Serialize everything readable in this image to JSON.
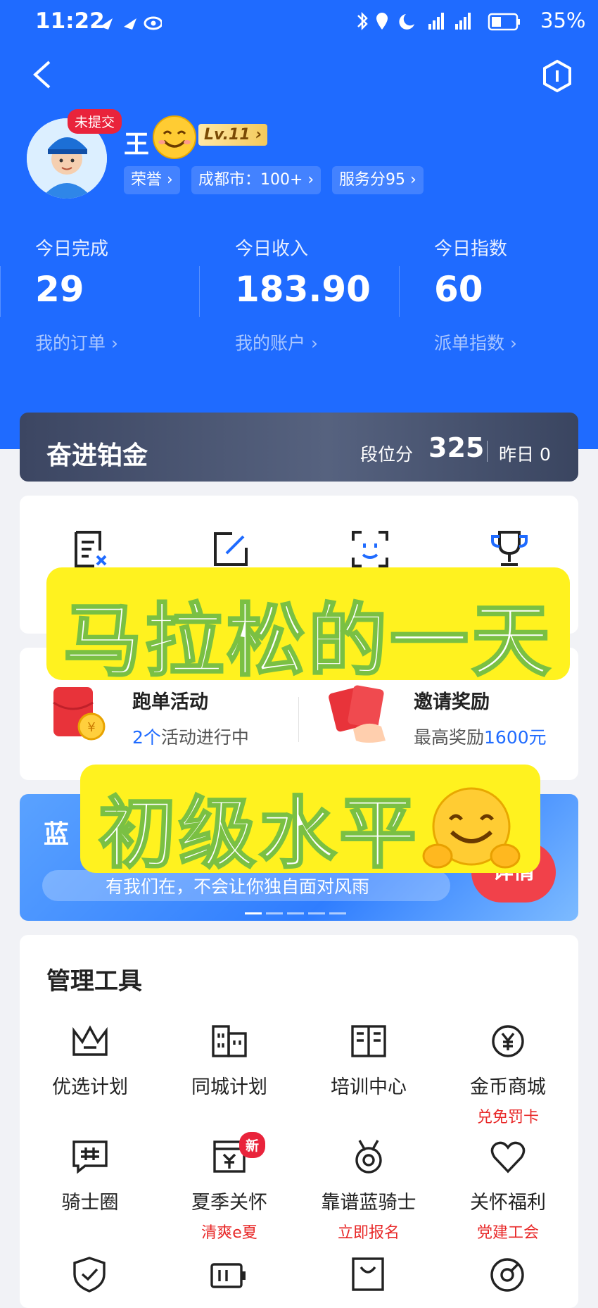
{
  "status_bar": {
    "time": "11:22",
    "battery": "35%"
  },
  "profile": {
    "name": "王",
    "unsubmitted_tag": "未提交",
    "level": "Lv.11 ›",
    "chips": [
      "荣誉 ›",
      "成都市：100+ ›",
      "服务分95 ›"
    ]
  },
  "stats": [
    {
      "label": "今日完成",
      "value": "29",
      "link": "我的订单 ›"
    },
    {
      "label": "今日收入",
      "value": "183.90",
      "link": "我的账户 ›"
    },
    {
      "label": "今日指数",
      "value": "60",
      "link": "派单指数 ›"
    }
  ],
  "rank": {
    "title": "奋进铂金",
    "label": "段位分",
    "score": "325",
    "yesterday": "昨日 0"
  },
  "overlay": {
    "line1": "马拉松的一天",
    "line2": "初级水平"
  },
  "activities": [
    {
      "title": "跑单活动",
      "sub_highlight": "2个",
      "sub_rest": "活动进行中"
    },
    {
      "title": "邀请奖励",
      "sub_prefix": "最高奖励",
      "sub_highlight": "1600元"
    }
  ],
  "banner": {
    "logo": "蓝",
    "text": "有我们在，不会让你独自面对风雨",
    "button": "详情"
  },
  "tools": {
    "title": "管理工具",
    "items": [
      {
        "label": "优选计划",
        "sub": ""
      },
      {
        "label": "同城计划",
        "sub": ""
      },
      {
        "label": "培训中心",
        "sub": ""
      },
      {
        "label": "金币商城",
        "sub": "兑免罚卡"
      },
      {
        "label": "骑士圈",
        "sub": ""
      },
      {
        "label": "夏季关怀",
        "sub": "清爽e夏",
        "badge": "新"
      },
      {
        "label": "靠谱蓝骑士",
        "sub": "立即报名"
      },
      {
        "label": "关怀福利",
        "sub": "党建工会"
      }
    ]
  },
  "colors": {
    "primary": "#1f6bff",
    "accent_red": "#e9233b",
    "overlay_yellow": "#fff21f"
  }
}
